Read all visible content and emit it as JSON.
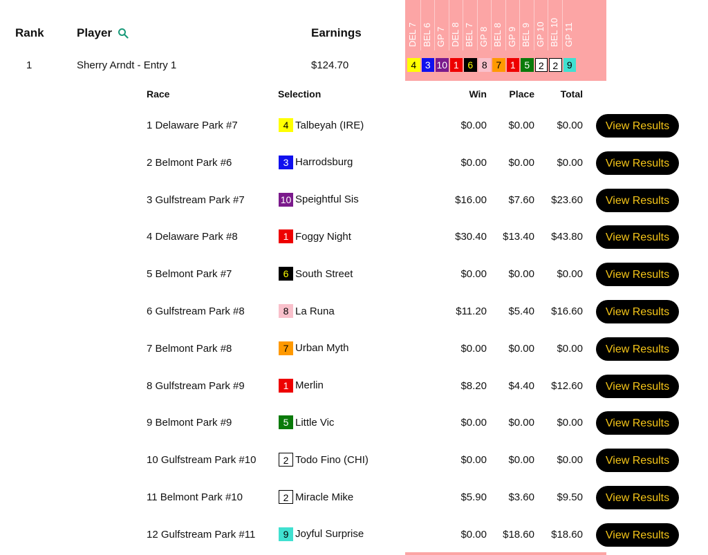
{
  "header": {
    "rank": "Rank",
    "player": "Player",
    "earnings": "Earnings"
  },
  "race_columns": [
    "DEL 7",
    "BEL 6",
    "GP 7",
    "DEL 8",
    "BEL 7",
    "GP 8",
    "BEL 8",
    "GP 9",
    "BEL 9",
    "GP 10",
    "BEL 10",
    "GP 11"
  ],
  "entry": {
    "rank": "1",
    "player": "Sherry Arndt - Entry 1",
    "earnings": "$124.70",
    "picks": [
      {
        "num": "4",
        "bg": "#ffff00",
        "fg": "#000000"
      },
      {
        "num": "3",
        "bg": "#1010ee",
        "fg": "#ffffff"
      },
      {
        "num": "10",
        "bg": "#7b1a8c",
        "fg": "#ffffff"
      },
      {
        "num": "1",
        "bg": "#ee0000",
        "fg": "#ffffff"
      },
      {
        "num": "6",
        "bg": "#000000",
        "fg": "#ffff00"
      },
      {
        "num": "8",
        "bg": "#f9c0cb",
        "fg": "#000000"
      },
      {
        "num": "7",
        "bg": "#ff9900",
        "fg": "#000000"
      },
      {
        "num": "1",
        "bg": "#ee0000",
        "fg": "#ffffff"
      },
      {
        "num": "5",
        "bg": "#0a7a0a",
        "fg": "#ffffff"
      },
      {
        "num": "2",
        "bg": "#ffffff",
        "fg": "#000000",
        "border": "#000000"
      },
      {
        "num": "2",
        "bg": "#ffffff",
        "fg": "#000000",
        "border": "#000000"
      },
      {
        "num": "9",
        "bg": "#40e0d0",
        "fg": "#000000"
      }
    ]
  },
  "detail_headers": {
    "race": "Race",
    "selection": "Selection",
    "win": "Win",
    "place": "Place",
    "total": "Total"
  },
  "button_label": "View Results",
  "races": [
    {
      "race": "1 Delaware Park #7",
      "num": "4",
      "bg": "#ffff00",
      "fg": "#000000",
      "horse": "Talbeyah (IRE)",
      "win": "$0.00",
      "place": "$0.00",
      "total": "$0.00"
    },
    {
      "race": "2 Belmont Park #6",
      "num": "3",
      "bg": "#1010ee",
      "fg": "#ffffff",
      "horse": "Harrodsburg",
      "win": "$0.00",
      "place": "$0.00",
      "total": "$0.00"
    },
    {
      "race": "3 Gulfstream Park #7",
      "num": "10",
      "bg": "#7b1a8c",
      "fg": "#ffffff",
      "horse": "Speightful Sis",
      "win": "$16.00",
      "place": "$7.60",
      "total": "$23.60"
    },
    {
      "race": "4 Delaware Park #8",
      "num": "1",
      "bg": "#ee0000",
      "fg": "#ffffff",
      "horse": "Foggy Night",
      "win": "$30.40",
      "place": "$13.40",
      "total": "$43.80"
    },
    {
      "race": "5 Belmont Park #7",
      "num": "6",
      "bg": "#000000",
      "fg": "#ffff00",
      "horse": "South Street",
      "win": "$0.00",
      "place": "$0.00",
      "total": "$0.00"
    },
    {
      "race": "6 Gulfstream Park #8",
      "num": "8",
      "bg": "#f9c0cb",
      "fg": "#000000",
      "horse": "La Runa",
      "win": "$11.20",
      "place": "$5.40",
      "total": "$16.60"
    },
    {
      "race": "7 Belmont Park #8",
      "num": "7",
      "bg": "#ff9900",
      "fg": "#000000",
      "horse": "Urban Myth",
      "win": "$0.00",
      "place": "$0.00",
      "total": "$0.00"
    },
    {
      "race": "8 Gulfstream Park #9",
      "num": "1",
      "bg": "#ee0000",
      "fg": "#ffffff",
      "horse": "Merlin",
      "win": "$8.20",
      "place": "$4.40",
      "total": "$12.60"
    },
    {
      "race": "9 Belmont Park #9",
      "num": "5",
      "bg": "#0a7a0a",
      "fg": "#ffffff",
      "horse": "Little Vic",
      "win": "$0.00",
      "place": "$0.00",
      "total": "$0.00"
    },
    {
      "race": "10 Gulfstream Park #10",
      "num": "2",
      "bg": "#ffffff",
      "fg": "#000000",
      "border": "#000000",
      "horse": "Todo Fino (CHI)",
      "win": "$0.00",
      "place": "$0.00",
      "total": "$0.00"
    },
    {
      "race": "11 Belmont Park #10",
      "num": "2",
      "bg": "#ffffff",
      "fg": "#000000",
      "border": "#000000",
      "horse": "Miracle Mike",
      "win": "$5.90",
      "place": "$3.60",
      "total": "$9.50"
    },
    {
      "race": "12 Gulfstream Park #11",
      "num": "9",
      "bg": "#40e0d0",
      "fg": "#000000",
      "horse": "Joyful Surprise",
      "win": "$0.00",
      "place": "$18.60",
      "total": "$18.60"
    }
  ]
}
